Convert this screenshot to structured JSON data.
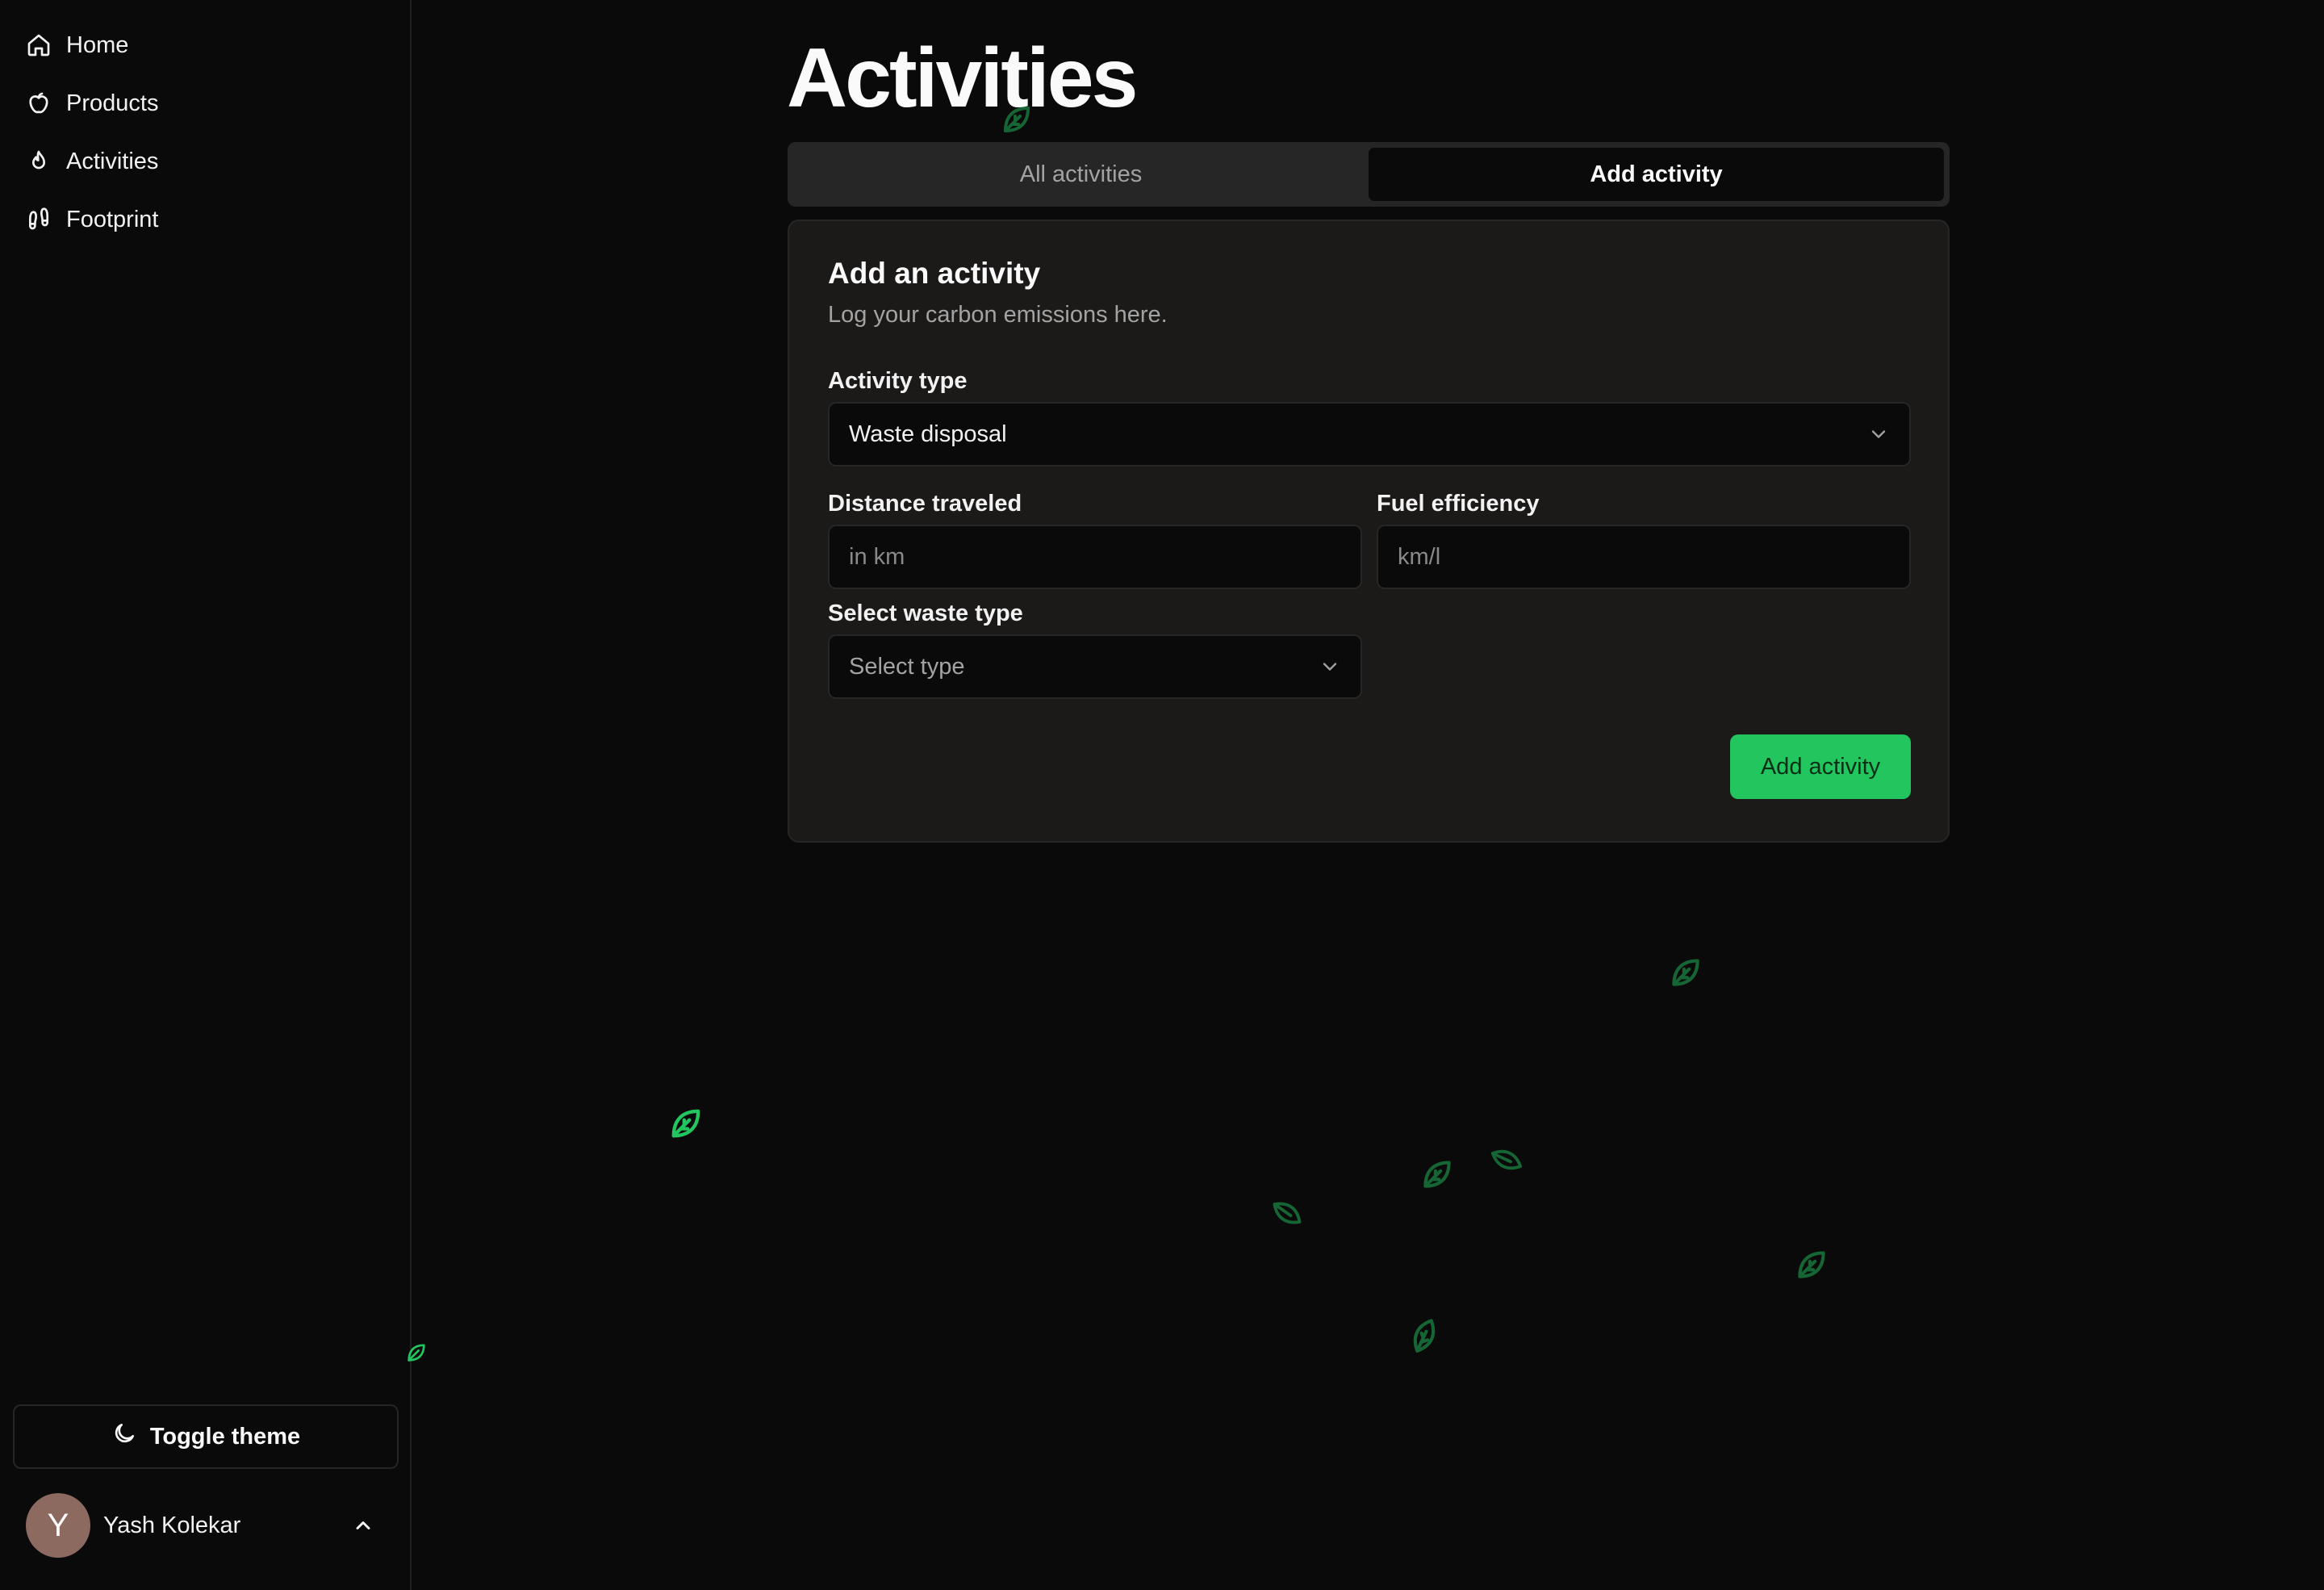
{
  "sidebar": {
    "items": [
      {
        "label": "Home",
        "icon": "home-icon"
      },
      {
        "label": "Products",
        "icon": "apple-icon"
      },
      {
        "label": "Activities",
        "icon": "flame-icon"
      },
      {
        "label": "Footprint",
        "icon": "footprints-icon"
      }
    ],
    "toggle_theme_label": "Toggle theme",
    "user": {
      "initial": "Y",
      "name": "Yash Kolekar"
    }
  },
  "page": {
    "title": "Activities"
  },
  "tabs": [
    {
      "label": "All activities",
      "active": false
    },
    {
      "label": "Add activity",
      "active": true
    }
  ],
  "form": {
    "title": "Add an activity",
    "description": "Log your carbon emissions here.",
    "activity_type": {
      "label": "Activity type",
      "value": "Waste disposal"
    },
    "distance": {
      "label": "Distance traveled",
      "placeholder": "in km"
    },
    "fuel_efficiency": {
      "label": "Fuel efficiency",
      "placeholder": "km/l"
    },
    "waste_type": {
      "label": "Select waste type",
      "placeholder": "Select type"
    },
    "submit_label": "Add activity"
  },
  "colors": {
    "background": "#0a0a0a",
    "card": "#1c1a19",
    "accent": "#22c55e",
    "leaf_dim": "#166534",
    "leaf_bright": "#22c55e"
  }
}
